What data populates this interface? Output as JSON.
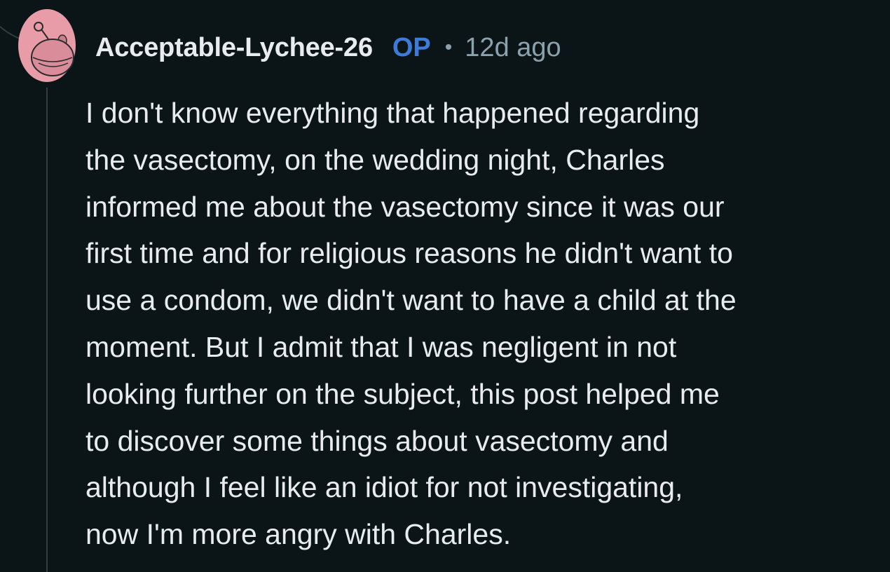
{
  "comment": {
    "author": "Acceptable-Lychee-26",
    "op_badge": "OP",
    "separator": "•",
    "timestamp": "12d ago",
    "body_lines": [
      "I don't know everything that happened regarding",
      "the vasectomy, on the wedding night, Charles",
      "informed me about the vasectomy since it was our",
      "first time and for religious reasons he didn't want to",
      "use a condom, we didn't want to have a child at the",
      "moment. But I admit that I was negligent in not",
      "looking further on the subject, this post helped me",
      "to discover some things about vasectomy and",
      "although I feel like an idiot for not investigating,",
      "now I'm more angry with Charles."
    ]
  },
  "icons": {
    "avatar": "reddit-snoo-avatar-icon"
  },
  "colors": {
    "background": "#0b1416",
    "text": "#e8ecee",
    "muted": "#8ba2ad",
    "op_accent": "#3d7bd9",
    "avatar_bg": "#e89ca8"
  }
}
